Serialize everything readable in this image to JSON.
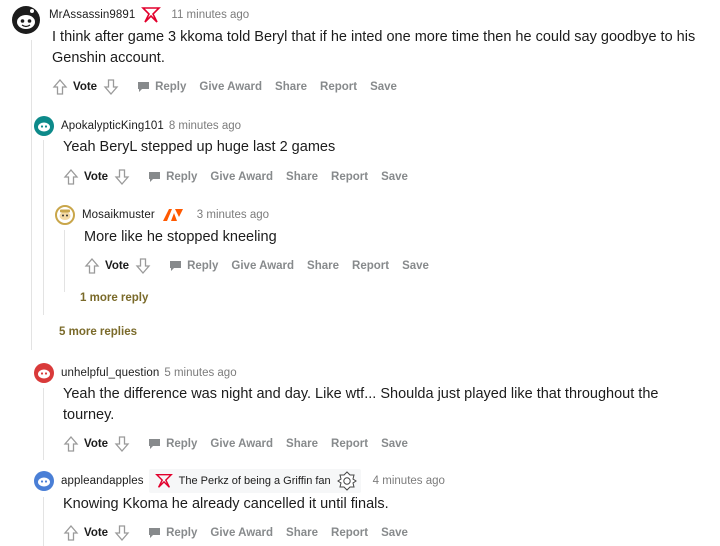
{
  "comments": [
    {
      "username": "MrAssassin9891",
      "timestamp": "11 minutes ago",
      "body": "I think after game 3 kkoma told Beryl that if he inted one more time then he could say goodbye to his Genshin account.",
      "flair_icon": "t1-logo-icon"
    },
    {
      "username": "ApokalypticKing101",
      "timestamp": "8 minutes ago",
      "body": "Yeah BeryL stepped up huge last 2 games"
    },
    {
      "username": "Mosaikmuster",
      "timestamp": "3 minutes ago",
      "body": "More like he stopped kneeling",
      "flair_icon": "fnatic-logo-icon"
    },
    {
      "username": "unhelpful_question",
      "timestamp": "5 minutes ago",
      "body": "Yeah the difference was night and day. Like wtf... Shoulda just played like that throughout the tourney."
    },
    {
      "username": "appleandapples",
      "timestamp": "4 minutes ago",
      "body": "Knowing Kkoma he already cancelled it until finals.",
      "flair_text": "The Perkz of being a Griffin fan",
      "flair_icon": "t1-logo-icon"
    }
  ],
  "actions": {
    "vote": "Vote",
    "reply": "Reply",
    "give_award": "Give Award",
    "share": "Share",
    "report": "Report",
    "save": "Save"
  },
  "more_links": {
    "one_more_reply": "1 more reply",
    "five_more_replies": "5 more replies"
  },
  "colors": {
    "link_gold": "#7a6a2a",
    "action_gray": "#878a8c",
    "t1_red": "#e2012d",
    "fnatic_orange": "#ff5900"
  }
}
